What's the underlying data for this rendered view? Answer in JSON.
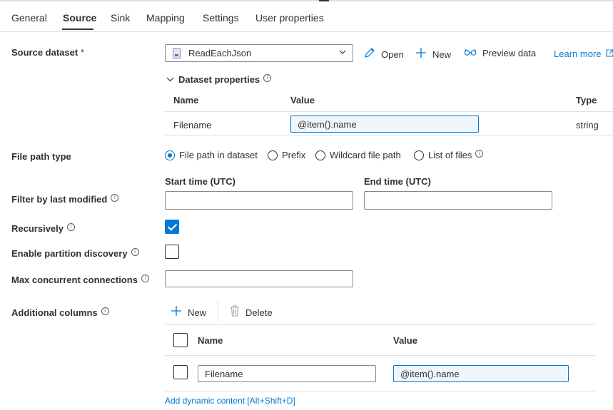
{
  "tabs": [
    {
      "label": "General"
    },
    {
      "label": "Source"
    },
    {
      "label": "Sink"
    },
    {
      "label": "Mapping"
    },
    {
      "label": "Settings"
    },
    {
      "label": "User properties"
    }
  ],
  "source_dataset": {
    "label": "Source dataset",
    "required_mark": "*",
    "selected": "ReadEachJson",
    "open_label": "Open",
    "new_label": "New",
    "preview_label": "Preview data",
    "learn_more_label": "Learn more"
  },
  "dataset_properties": {
    "title": "Dataset properties",
    "columns": {
      "name": "Name",
      "value": "Value",
      "type": "Type"
    },
    "rows": [
      {
        "name": "Filename",
        "value": "@item().name",
        "type": "string"
      }
    ]
  },
  "file_path_type": {
    "label": "File path type",
    "options": [
      "File path in dataset",
      "Prefix",
      "Wildcard file path",
      "List of files"
    ],
    "selected_index": 0
  },
  "filter_last_modified": {
    "label": "Filter by last modified",
    "start_label": "Start time (UTC)",
    "end_label": "End time (UTC)",
    "start_value": "",
    "end_value": ""
  },
  "recursively": {
    "label": "Recursively",
    "checked": true
  },
  "partition_discovery": {
    "label": "Enable partition discovery",
    "checked": false
  },
  "max_connections": {
    "label": "Max concurrent connections",
    "value": ""
  },
  "additional_columns": {
    "label": "Additional columns",
    "new_label": "New",
    "delete_label": "Delete",
    "columns": {
      "name": "Name",
      "value": "Value"
    },
    "rows": [
      {
        "name": "Filename",
        "value": "@item().name"
      }
    ],
    "dynamic_content_label": "Add dynamic content [Alt+Shift+D]"
  },
  "icons": {
    "info": "info-icon",
    "open": "pencil-icon",
    "new": "plus-icon",
    "preview": "glasses-icon",
    "external": "external-link-icon",
    "delete": "trash-icon",
    "dataset": "dataset-icon",
    "chevron": "chevron-down-icon"
  },
  "colors": {
    "accent": "#0078d4",
    "text": "#323130",
    "required": "#a4262c",
    "border": "#8a8886"
  }
}
